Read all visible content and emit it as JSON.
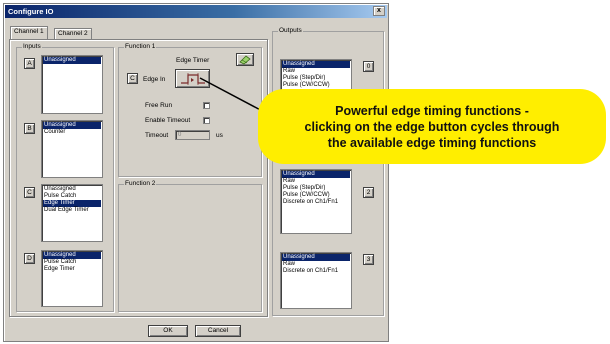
{
  "window": {
    "title": "Configure IO",
    "close_glyph": "x"
  },
  "tabs": [
    {
      "label": "Channel 1",
      "active": true
    },
    {
      "label": "Channel 2",
      "active": false
    }
  ],
  "inputs": {
    "label": "Inputs",
    "rows": [
      {
        "letter": "A",
        "items": [
          "Unassigned"
        ],
        "selected": 0
      },
      {
        "letter": "B",
        "items": [
          "Unassigned",
          "Counter"
        ],
        "selected": 0
      },
      {
        "letter": "C",
        "items": [
          "Unassigned",
          "Pulse Catch",
          "Edge Timer",
          "Dual Edge Timer"
        ],
        "selected": 2
      },
      {
        "letter": "D",
        "items": [
          "Unassigned",
          "Pulse Catch",
          "Edge Timer"
        ],
        "selected": 0
      }
    ]
  },
  "function1": {
    "label": "Function 1",
    "title": "Edge Timer",
    "letter": "C",
    "edge_in_label": "Edge In",
    "free_run_label": "Free Run",
    "enable_timeout_label": "Enable Timeout",
    "timeout_label": "Timeout",
    "timeout_value": "0",
    "timeout_unit": "us"
  },
  "function2": {
    "label": "Function 2"
  },
  "outputs": {
    "label": "Outputs",
    "rows": [
      {
        "number": "0",
        "items": [
          "Unassigned",
          "Raw",
          "Pulse (Step/Dir)",
          "Pulse (CW/CCW)"
        ],
        "selected": 0
      },
      {
        "number": "2",
        "items": [
          "Unassigned",
          "Raw",
          "Pulse (Step/Dir)",
          "Pulse (CW/CCW)",
          "Discrete on Ch1/Fn1"
        ],
        "selected": 0
      },
      {
        "number": "3",
        "items": [
          "Unassigned",
          "Raw",
          "Discrete on Ch1/Fn1"
        ],
        "selected": 0
      }
    ]
  },
  "buttons": {
    "ok": "OK",
    "cancel": "Cancel"
  },
  "callout": {
    "lines": [
      "Powerful edge timing functions -",
      "clicking on the edge button cycles through",
      "the available edge timing functions"
    ]
  },
  "colors": {
    "callout": "#ffee00",
    "selection": "#0a246a",
    "dialog": "#d4d0c8"
  }
}
